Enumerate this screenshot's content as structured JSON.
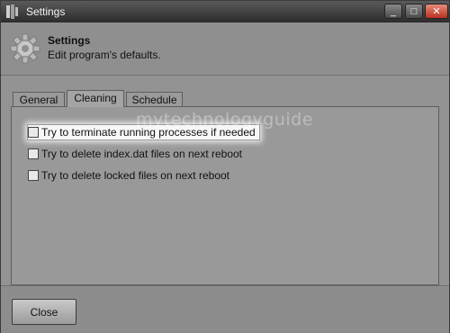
{
  "window": {
    "title": "Settings",
    "controls": {
      "minimize": "_",
      "maximize": "□",
      "close": "✕"
    }
  },
  "header": {
    "icon": "gear-icon",
    "title": "Settings",
    "subtitle": "Edit program's defaults."
  },
  "tabs": [
    {
      "label": "General",
      "active": false
    },
    {
      "label": "Cleaning",
      "active": true
    },
    {
      "label": "Schedule",
      "active": false
    }
  ],
  "options": [
    {
      "label": "Try to terminate running processes if needed",
      "checked": false
    },
    {
      "label": "Try to delete index.dat files on next reboot",
      "checked": false
    },
    {
      "label": "Try to delete locked files on next reboot",
      "checked": false
    }
  ],
  "watermark": "mytechnologyguide",
  "footer": {
    "close_label": "Close"
  }
}
